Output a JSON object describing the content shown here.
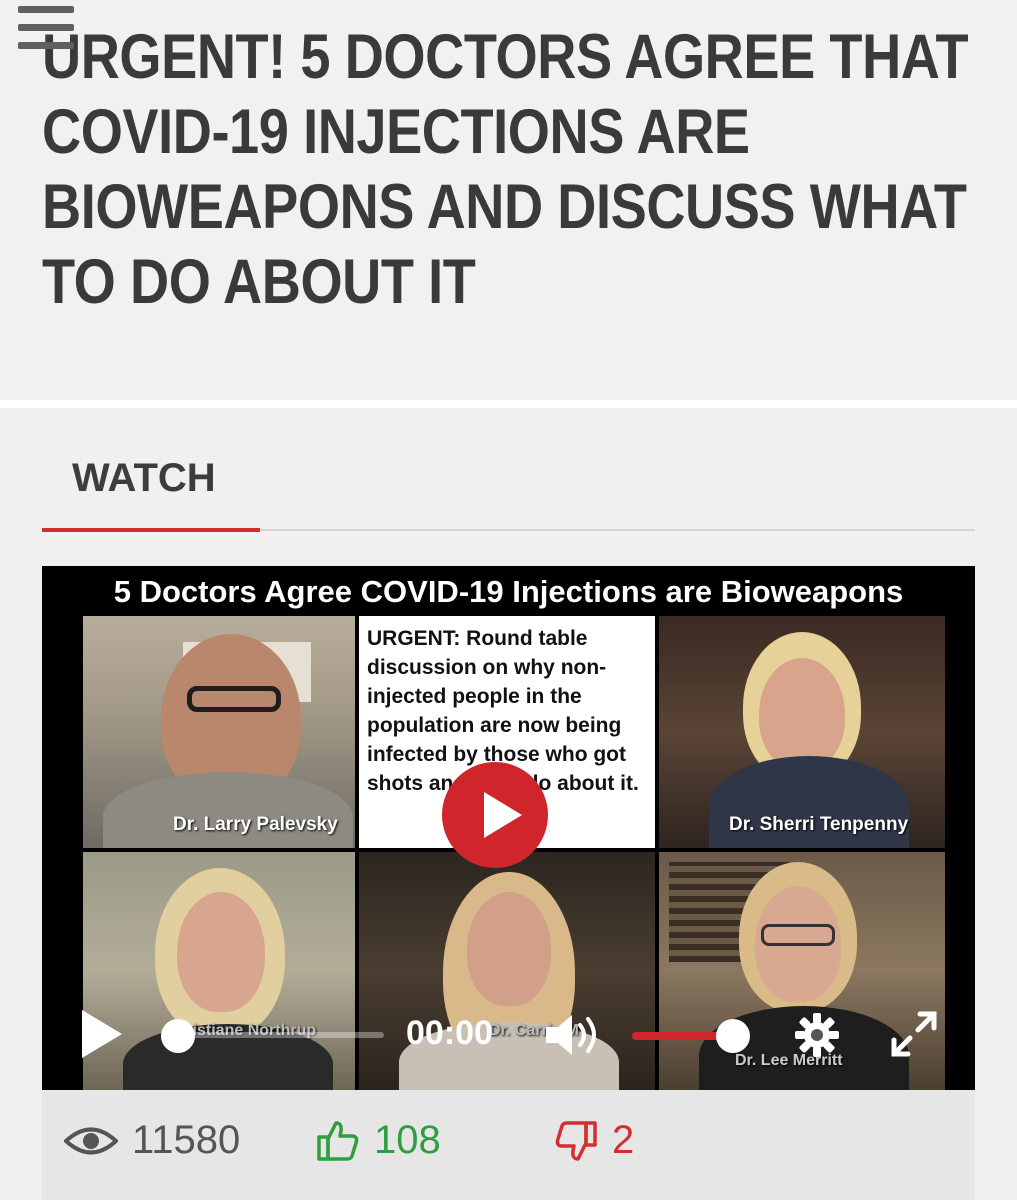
{
  "headline": "URGENT! 5 DOCTORS AGREE THAT COVID-19 INJECTIONS ARE BIOWEAPONS AND DISCUSS WHAT TO DO ABOUT IT",
  "section_label": "WATCH",
  "video": {
    "banner_title": "5 Doctors Agree COVID-19 Injections are Bioweapons",
    "urgent_text": "URGENT: Round table discussion on why non-injected people in the population are now being infected by those who got shots and what do about it.",
    "participants": {
      "top_left": "Dr. Larry Palevsky",
      "top_right": "Dr. Sherri Tenpenny",
      "bottom_left": "Christiane Northrup",
      "bottom_middle": "Dr. Carrie M",
      "bottom_right": "Dr. Lee Merritt"
    },
    "time": "00:00",
    "progress": 0,
    "volume": 1.0
  },
  "stats": {
    "views": "11580",
    "likes": "108",
    "dislikes": "2"
  },
  "colors": {
    "accent_red": "#d32f2f",
    "like_green": "#2e9e3f",
    "headline_text": "#3a3a3a"
  },
  "icons": {
    "menu": "hamburger-menu-icon",
    "play": "play-icon",
    "volume": "volume-icon",
    "settings": "gear-icon",
    "fullscreen": "expand-icon",
    "views": "eye-icon",
    "like": "thumbs-up-icon",
    "dislike": "thumbs-down-icon"
  }
}
